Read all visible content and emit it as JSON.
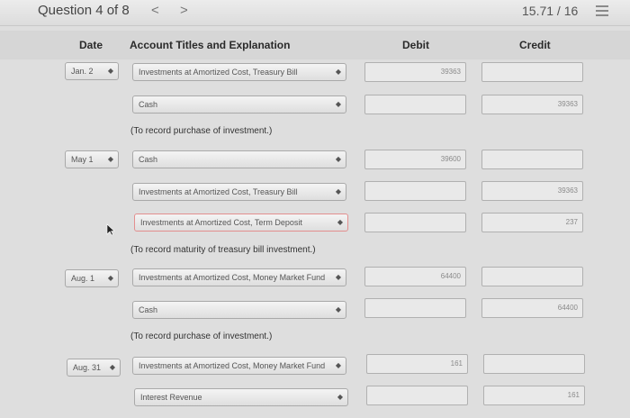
{
  "topbar": {
    "question_label": "Question 4 of 8",
    "prev_icon": "chevron-left-icon",
    "next_icon": "chevron-right-icon",
    "prev_glyph": "<",
    "next_glyph": ">",
    "score": "15.71 / 16",
    "list_icon": "list-icon"
  },
  "headers": {
    "date": "Date",
    "account": "Account Titles and Explanation",
    "debit": "Debit",
    "credit": "Credit"
  },
  "rows": [
    {
      "date": "Jan. 2",
      "account": "Investments at Amortized Cost, Treasury Bill",
      "debit": "39363",
      "credit": ""
    },
    {
      "date": "",
      "account": "Cash",
      "debit": "",
      "credit": "39363"
    },
    {
      "date": "May 1",
      "account": "Cash",
      "debit": "39600",
      "credit": ""
    },
    {
      "date": "",
      "account": "Investments at Amortized Cost, Treasury Bill",
      "debit": "",
      "credit": "39363"
    },
    {
      "date": "",
      "account": "Investments at Amortized Cost, Term Deposit",
      "debit": "",
      "credit": "237"
    },
    {
      "date": "Aug. 1",
      "account": "Investments at Amortized Cost, Money Market Fund",
      "debit": "64400",
      "credit": ""
    },
    {
      "date": "",
      "account": "Cash",
      "debit": "",
      "credit": "64400"
    },
    {
      "date": "Aug. 31",
      "account": "Investments at Amortized Cost, Money Market Fund",
      "debit": "161",
      "credit": ""
    },
    {
      "date": "",
      "account": "Interest Revenue",
      "debit": "",
      "credit": "161"
    }
  ],
  "notes": [
    "(To record purchase of investment.)",
    "(To record maturity of treasury bill investment.)",
    "(To record purchase of investment.)"
  ],
  "dropdown_glyph": "◆",
  "highlight_color": "#e38f8f"
}
